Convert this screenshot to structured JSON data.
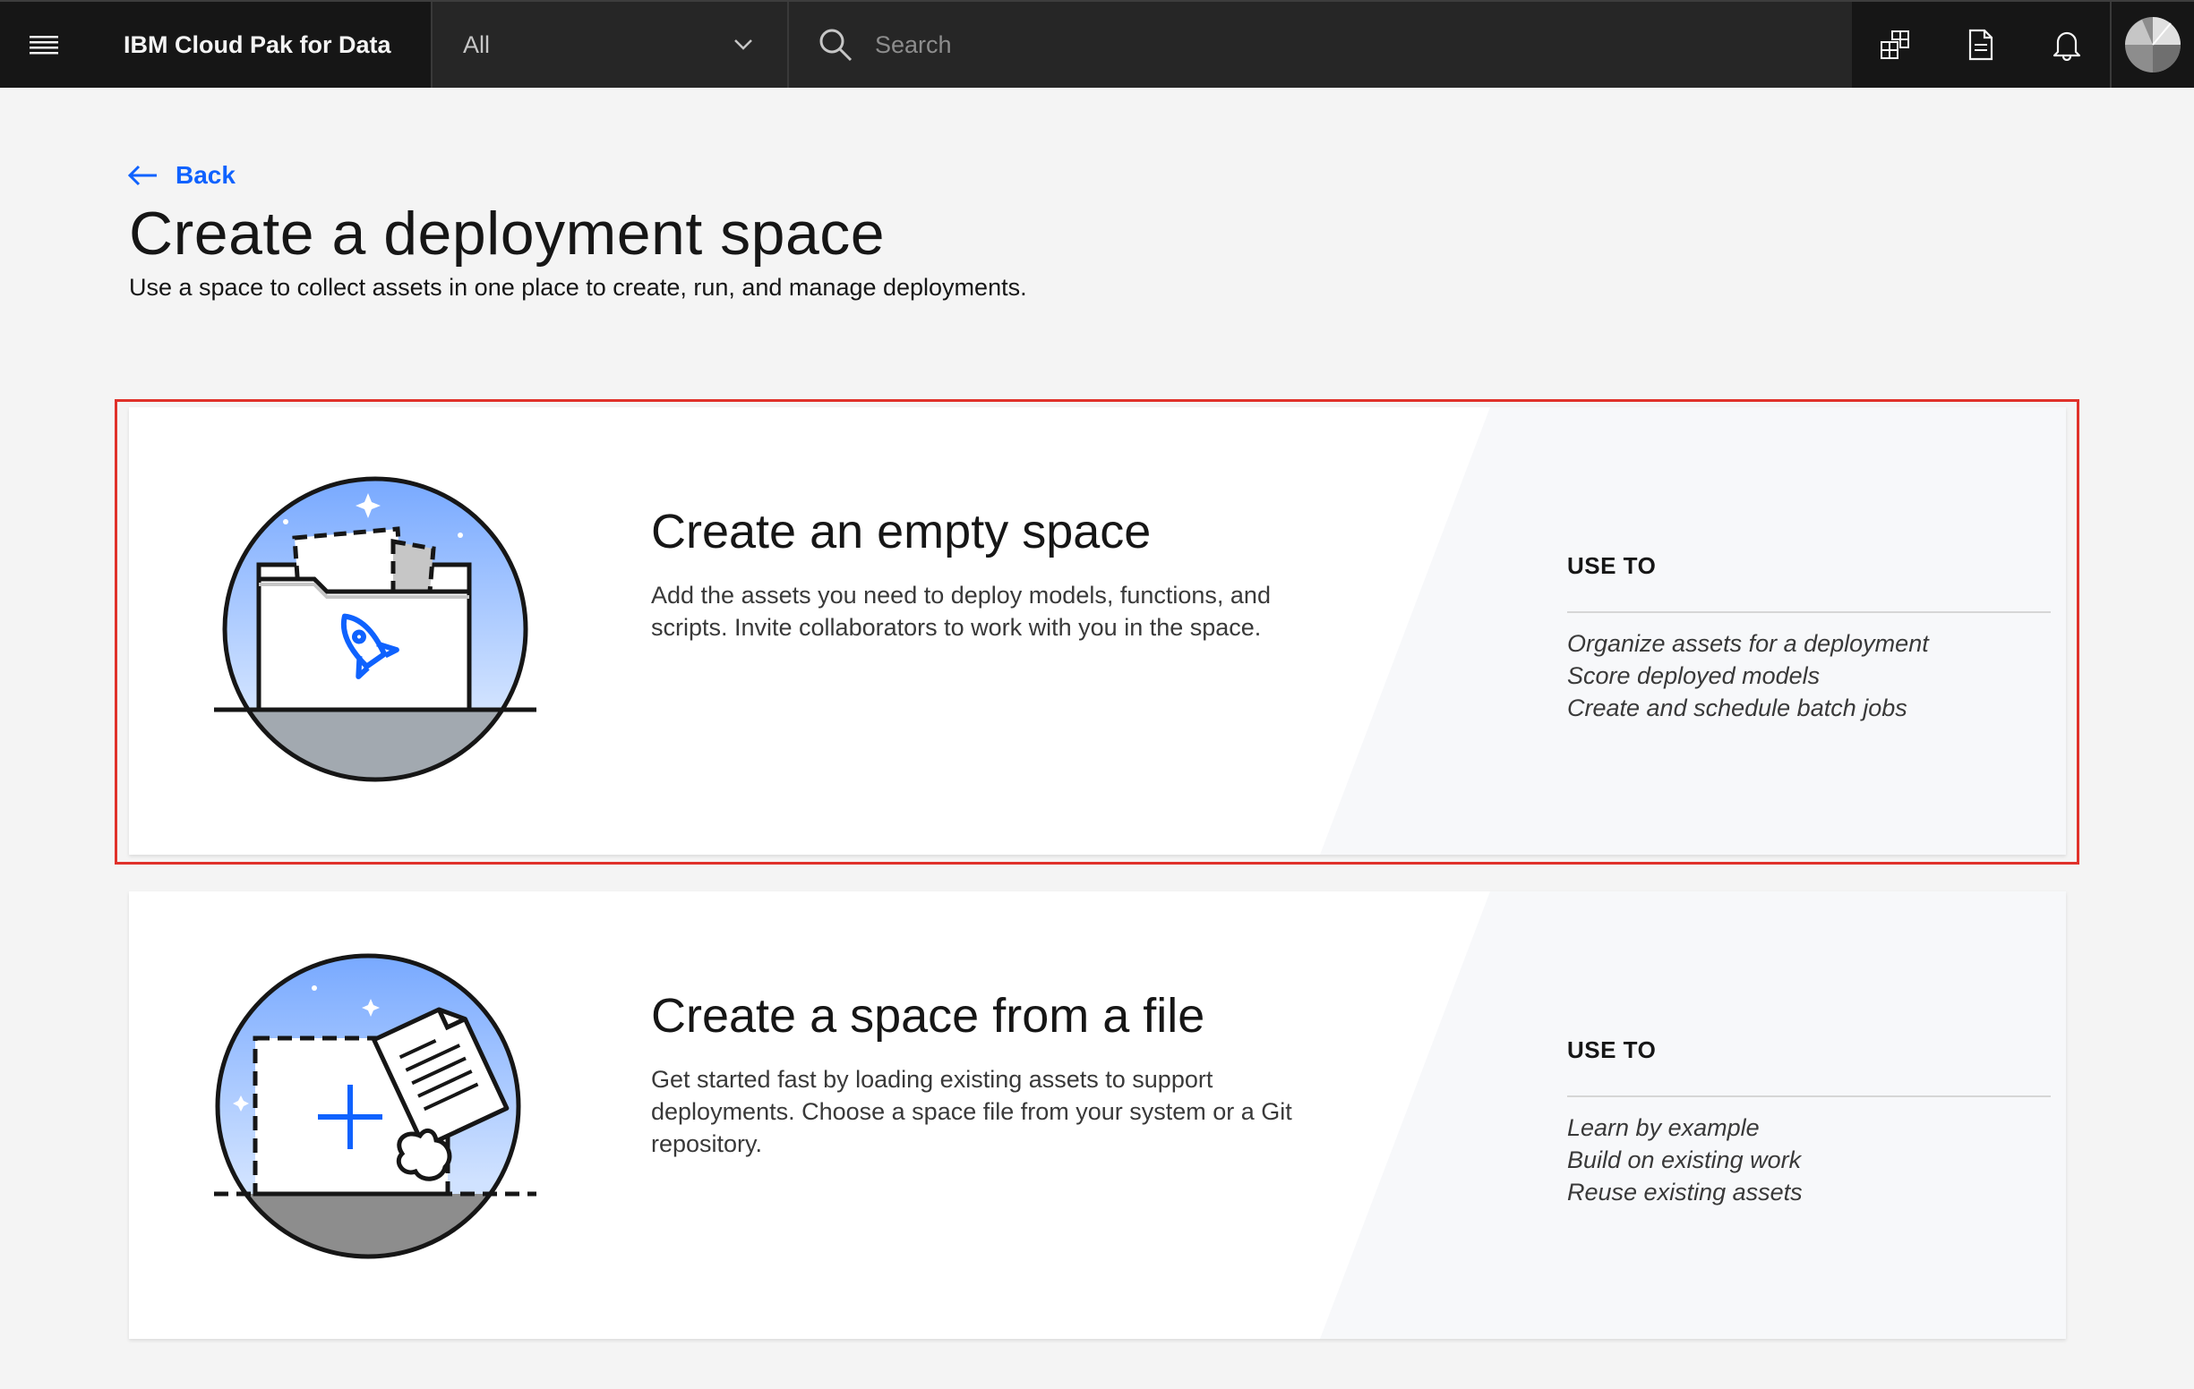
{
  "header": {
    "brand": "IBM Cloud Pak for Data",
    "scope_selected": "All",
    "search_placeholder": "Search",
    "icons": [
      "menu-icon",
      "chevron-down-icon",
      "search-icon",
      "catalog-icon",
      "document-icon",
      "notification-icon",
      "avatar"
    ]
  },
  "page": {
    "back_label": "Back",
    "title": "Create a deployment space",
    "subtitle": "Use a space to collect assets in one place to create, run, and manage deployments."
  },
  "cards": [
    {
      "title": "Create an empty space",
      "description": "Add the assets you need to deploy models, functions, and scripts. Invite collaborators to work with you in the space.",
      "use_to_label": "USE TO",
      "uses": [
        "Organize assets for a deployment",
        "Score deployed models",
        "Create and schedule batch jobs"
      ],
      "illustration": "folder-rocket-illustration",
      "highlighted": true
    },
    {
      "title": "Create a space from a file",
      "description": "Get started fast by loading existing assets to support deployments. Choose a space file from your system or a Git repository.",
      "use_to_label": "USE TO",
      "uses": [
        "Learn by example",
        "Build on existing work",
        "Reuse existing assets"
      ],
      "illustration": "file-import-illustration",
      "highlighted": false
    }
  ],
  "colors": {
    "header_bg": "#262626",
    "header_dark": "#161616",
    "link": "#0f62fe",
    "highlight_border": "#e0312a",
    "page_bg": "#f4f4f4"
  }
}
